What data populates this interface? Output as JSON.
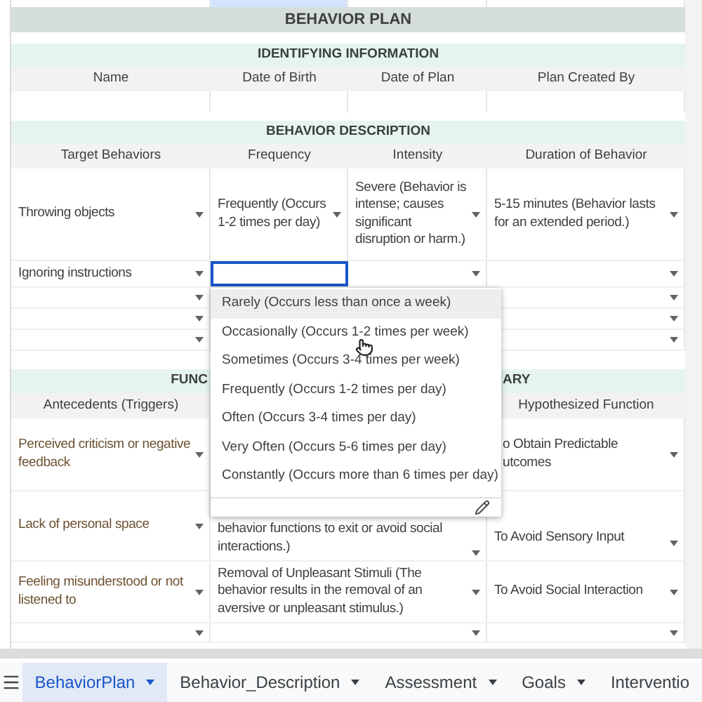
{
  "title": "BEHAVIOR PLAN",
  "identifying": {
    "title": "IDENTIFYING INFORMATION",
    "columns": [
      "Name",
      "Date of Birth",
      "Date of Plan",
      "Plan Created By"
    ]
  },
  "behavior_description": {
    "title": "BEHAVIOR DESCRIPTION",
    "columns": [
      "Target Behaviors",
      "Frequency",
      "Intensity",
      "Duration of Behavior"
    ],
    "rows": [
      {
        "target": "Throwing objects",
        "frequency": "Frequently (Occurs 1-2 times per day)",
        "intensity": "Severe (Behavior is intense; causes significant disruption or harm.)",
        "duration": "5-15 minutes (Behavior lasts for an extended period.)",
        "frequency_selected": false
      },
      {
        "target": "Ignoring instructions",
        "frequency_selected": true
      },
      {
        "frequency_selected": false
      },
      {
        "frequency_selected": false
      },
      {
        "frequency_selected": false
      }
    ]
  },
  "dropdown": {
    "options": [
      {
        "label": "Rarely (Occurs less than once a week)",
        "highlighted": true
      },
      {
        "label": "Occasionally (Occurs 1-2 times per week)",
        "highlighted": false
      },
      {
        "label": "Sometimes (Occurs 3-4 times per week)",
        "highlighted": false
      },
      {
        "label": "Frequently (Occurs 1-2 times per day)",
        "highlighted": false
      },
      {
        "label": "Often (Occurs 3-4 times per day)",
        "highlighted": false
      },
      {
        "label": "Very Often (Occurs 5-6 times per day)",
        "highlighted": false
      },
      {
        "label": "Constantly (Occurs more than 6 times per day)",
        "highlighted": false
      }
    ]
  },
  "functional_summary": {
    "title_left_part": "FUNC",
    "title_right_part": "ARY",
    "columns": [
      "Antecedents (Triggers)",
      "Hypothesized Function"
    ],
    "rows": [
      {
        "antecedent": "Perceived criticism or negative feedback",
        "function": "o Obtain Predictable\nutcomes"
      },
      {
        "antecedent": "Lack of personal space",
        "consequence": "behavior functions to exit or avoid social\ninteractions.)",
        "function": "To Avoid Sensory Input"
      },
      {
        "antecedent": "Feeling misunderstood or not listened to",
        "consequence": "Removal of Unpleasant Stimuli (The\nbehavior results in the removal of an\naversive or unpleasant stimulus.)",
        "function": "To Avoid Social Interaction"
      },
      {}
    ]
  },
  "sheet_tabs": [
    {
      "label": "BehaviorPlan",
      "selected": true
    },
    {
      "label": "Behavior_Description",
      "selected": false
    },
    {
      "label": "Assessment",
      "selected": false
    },
    {
      "label": "Goals",
      "selected": false
    },
    {
      "label": "Interventio",
      "selected": false
    }
  ]
}
